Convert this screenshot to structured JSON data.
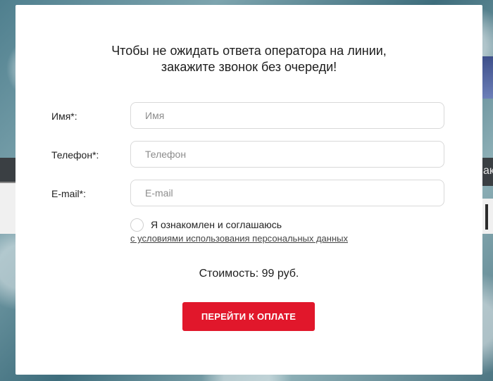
{
  "background": {
    "right_partial_text": "ак"
  },
  "modal": {
    "heading_line1": "Чтобы не ожидать ответа оператора на линии,",
    "heading_line2": "закажите звонок без очереди!",
    "fields": {
      "name": {
        "label": "Имя*:",
        "placeholder": "Имя",
        "value": ""
      },
      "phone": {
        "label": "Телефон*:",
        "placeholder": "Телефон",
        "value": ""
      },
      "email": {
        "label": "E-mail*:",
        "placeholder": "E-mail",
        "value": ""
      }
    },
    "consent": {
      "checked": false,
      "text": "Я ознакомлен и соглашаюсь",
      "link_text": "с условиями использования персональных данных"
    },
    "price_text": "Стоимость: 99 руб.",
    "pay_button_label": "ПЕРЕЙТИ К ОПЛАТЕ",
    "accent_color": "#e1172b"
  }
}
